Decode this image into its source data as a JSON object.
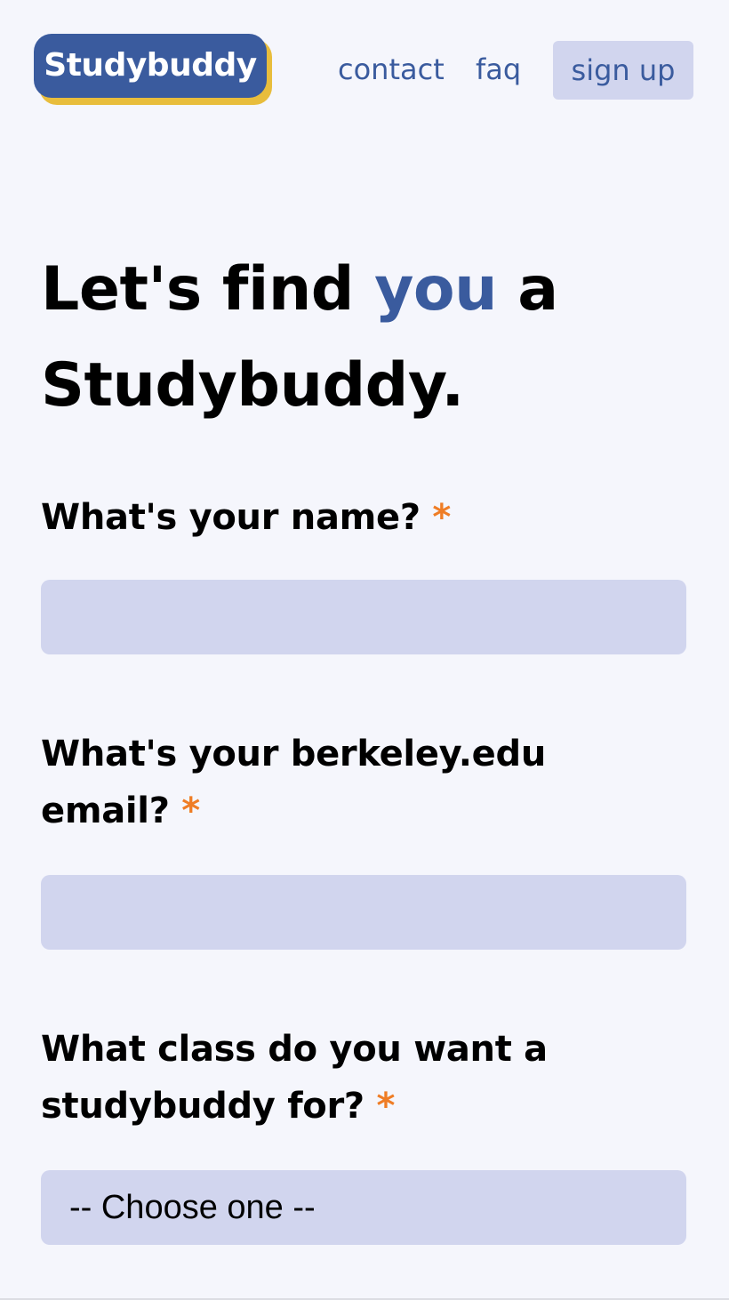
{
  "brand": {
    "logo_text": "Studybuddy",
    "primary_color": "#3a5b9e",
    "shadow_color": "#e8bd3c",
    "accent_required_color": "#ef7d25"
  },
  "nav": {
    "contact": "contact",
    "faq": "faq",
    "sign_up": "sign up"
  },
  "hero": {
    "part1": "Let's find ",
    "highlight": "you",
    "part2": " a Studybuddy."
  },
  "form": {
    "name": {
      "label": "What's your name?",
      "required_mark": "*",
      "value": ""
    },
    "email": {
      "label": "What's your berkeley.edu email?",
      "required_mark": "*",
      "value": ""
    },
    "class": {
      "label": "What class do you want a studybuddy for?",
      "required_mark": "*",
      "selected": "-- Choose one --"
    }
  }
}
